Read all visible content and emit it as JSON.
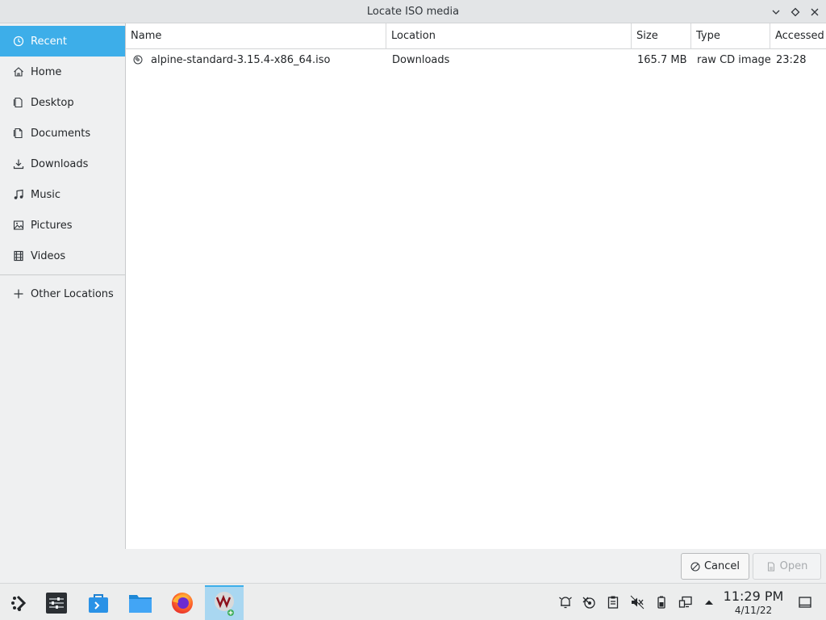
{
  "window": {
    "title": "Locate ISO media"
  },
  "sidebar": {
    "items": [
      {
        "label": "Recent",
        "icon": "clock-icon"
      },
      {
        "label": "Home",
        "icon": "home-icon"
      },
      {
        "label": "Desktop",
        "icon": "desktop-icon"
      },
      {
        "label": "Documents",
        "icon": "documents-icon"
      },
      {
        "label": "Downloads",
        "icon": "download-icon"
      },
      {
        "label": "Music",
        "icon": "music-icon"
      },
      {
        "label": "Pictures",
        "icon": "pictures-icon"
      },
      {
        "label": "Videos",
        "icon": "videos-icon"
      }
    ],
    "other": {
      "label": "Other Locations",
      "icon": "plus-icon"
    }
  },
  "columns": {
    "name": "Name",
    "location": "Location",
    "size": "Size",
    "type": "Type",
    "accessed": "Accessed"
  },
  "files": [
    {
      "name": "alpine-standard-3.15.4-x86_64.iso",
      "location": "Downloads",
      "size": "165.7 MB",
      "type": "raw CD image",
      "accessed": "23:28"
    }
  ],
  "buttons": {
    "cancel": "Cancel",
    "open": "Open"
  },
  "taskbar": {
    "time": "11:29 PM",
    "date": "4/11/22"
  },
  "colors": {
    "accent": "#3daee9",
    "active_task": "#a9d7f1"
  }
}
